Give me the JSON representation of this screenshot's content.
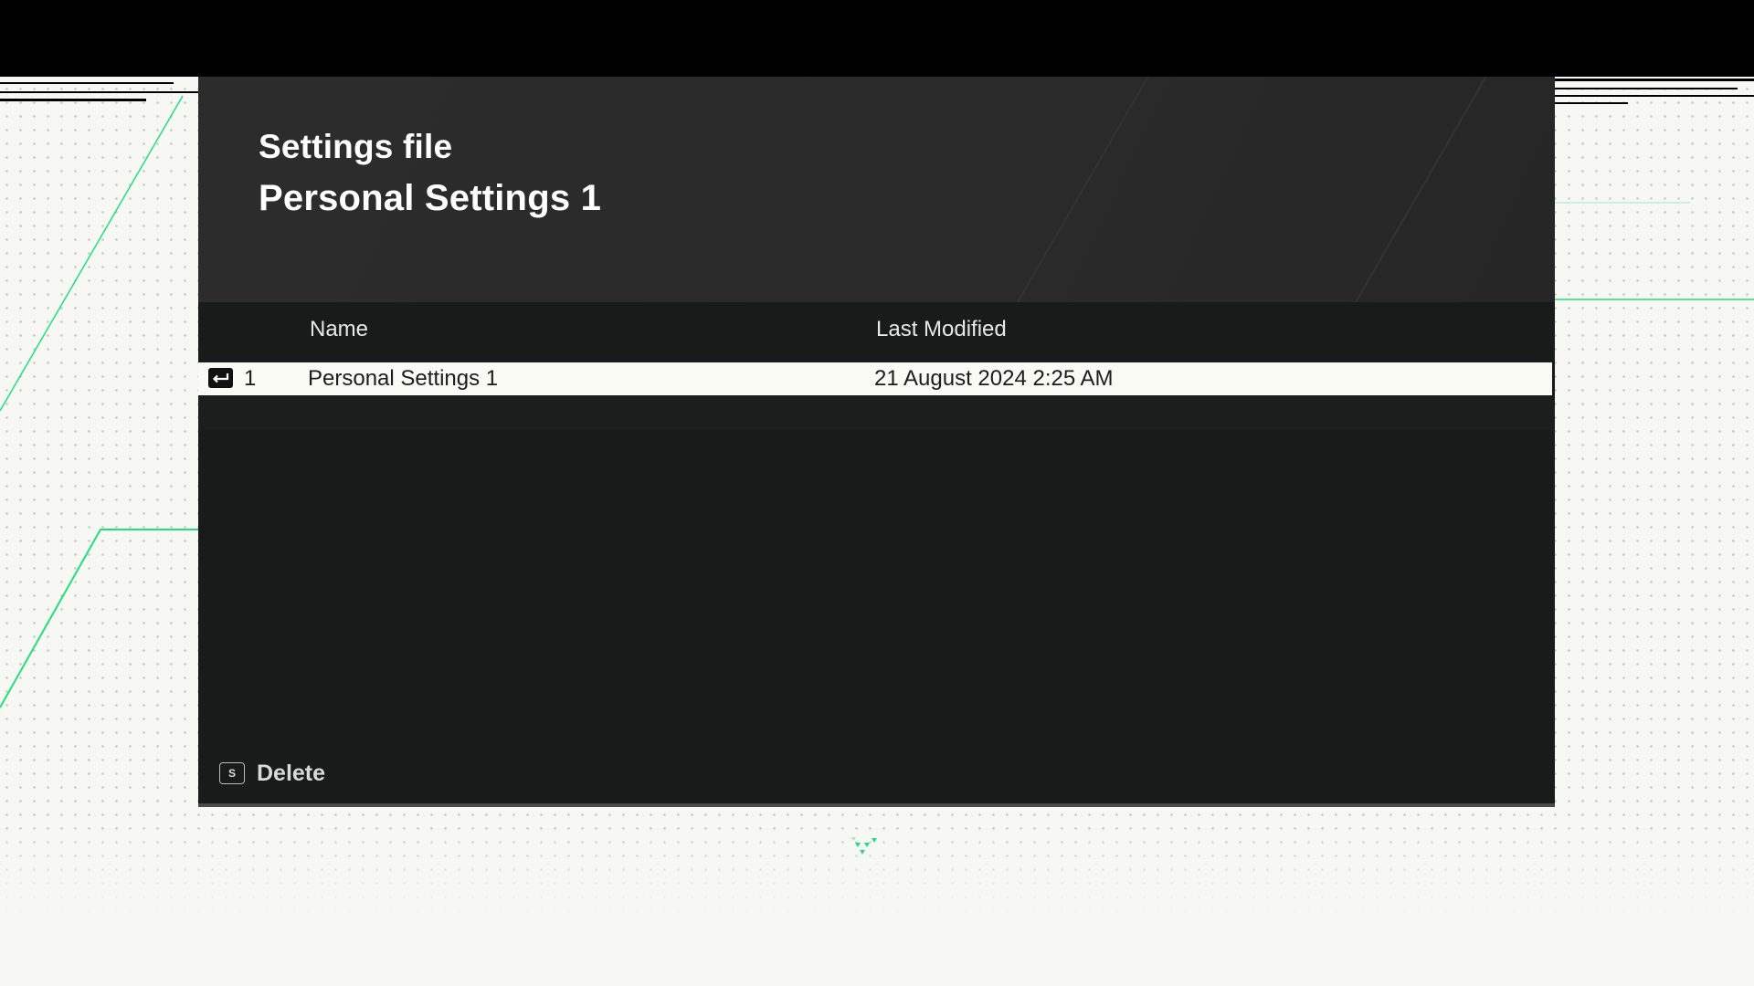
{
  "header": {
    "title": "Settings file",
    "subtitle": "Personal Settings 1"
  },
  "table": {
    "columns": [
      "Name",
      "Last Modified"
    ],
    "rows": [
      {
        "index": "1",
        "name": "Personal Settings 1",
        "last_modified": "21 August 2024 2:25 AM",
        "selected": true
      }
    ]
  },
  "footer": {
    "delete_key": "S",
    "delete_label": "Delete"
  },
  "colors": {
    "accent": "#1fe07a",
    "panel": "#191a1a",
    "header": "#2c2c2c",
    "selected_row": "#fafaf5",
    "background": "#f7f8f3"
  },
  "icons": {
    "row_indicator": "enter-icon",
    "loading": "loading-spinner-icon"
  }
}
